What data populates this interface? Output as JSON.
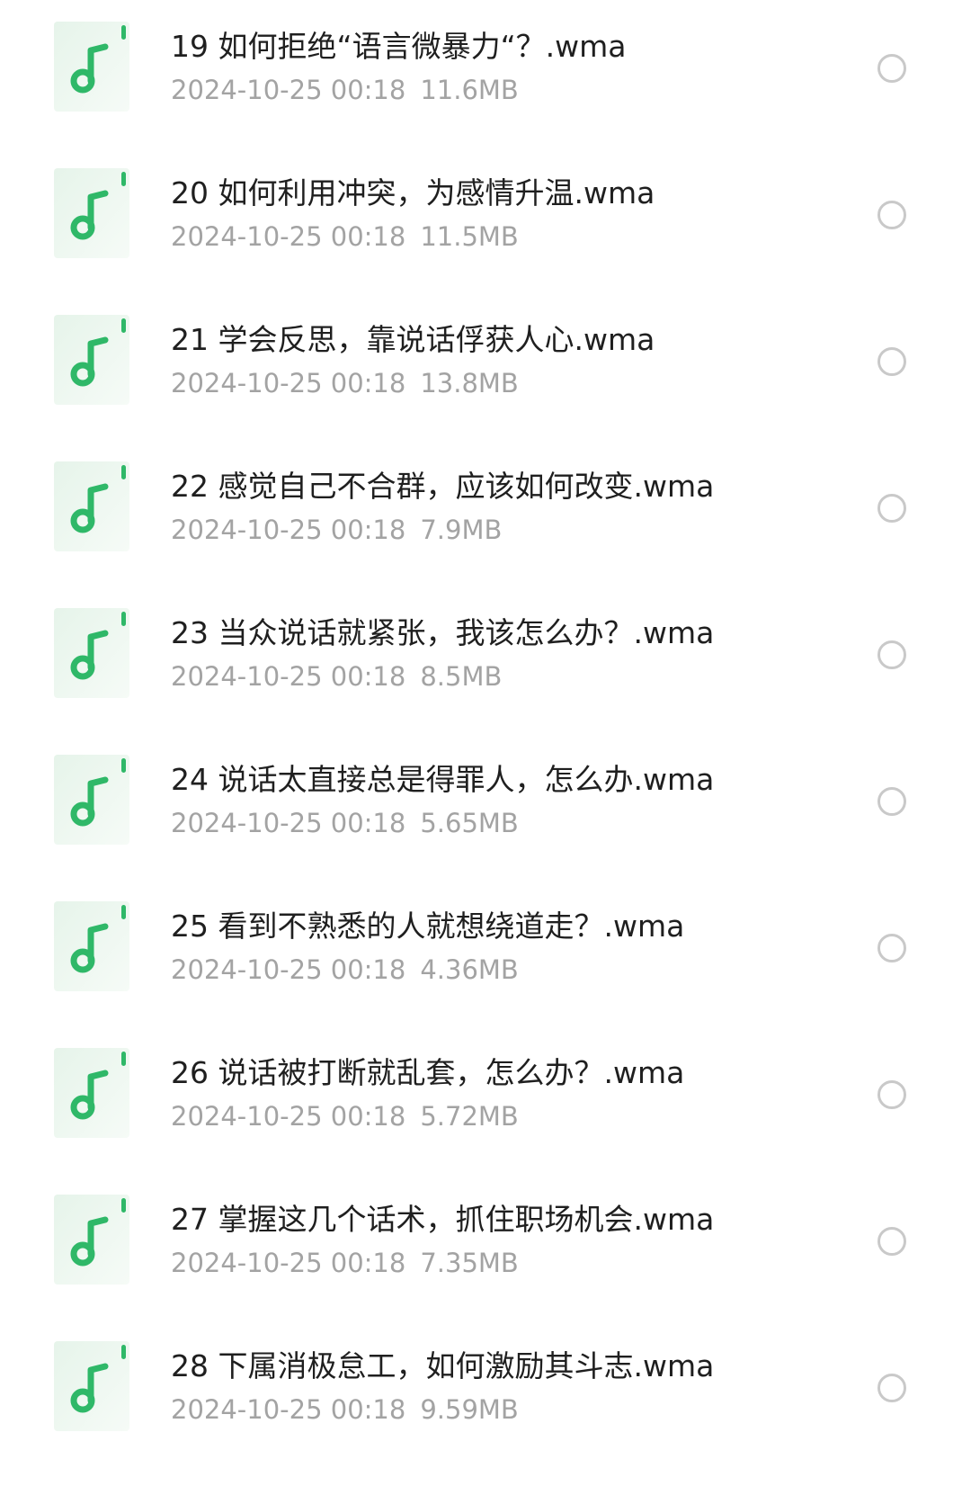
{
  "files": [
    {
      "name": "19 如何拒绝“语言微暴力“？.wma",
      "date": "2024-10-25 00:18",
      "size": "11.6MB",
      "icon": "music-file-icon"
    },
    {
      "name": "20 如何利用冲突，为感情升温.wma",
      "date": "2024-10-25 00:18",
      "size": "11.5MB",
      "icon": "music-file-icon"
    },
    {
      "name": "21 学会反思，靠说话俘获人心.wma",
      "date": "2024-10-25 00:18",
      "size": "13.8MB",
      "icon": "music-file-icon"
    },
    {
      "name": "22 感觉自己不合群，应该如何改变.wma",
      "date": "2024-10-25 00:18",
      "size": "7.9MB",
      "icon": "music-file-icon"
    },
    {
      "name": "23 当众说话就紧张，我该怎么办？.wma",
      "date": "2024-10-25 00:18",
      "size": "8.5MB",
      "icon": "music-file-icon"
    },
    {
      "name": "24 说话太直接总是得罪人，怎么办.wma",
      "date": "2024-10-25 00:18",
      "size": "5.65MB",
      "icon": "music-file-icon"
    },
    {
      "name": "25 看到不熟悉的人就想绕道走？.wma",
      "date": "2024-10-25 00:18",
      "size": "4.36MB",
      "icon": "music-file-icon"
    },
    {
      "name": "26 说话被打断就乱套，怎么办？.wma",
      "date": "2024-10-25 00:18",
      "size": "5.72MB",
      "icon": "music-file-icon"
    },
    {
      "name": "27 掌握这几个话术，抓住职场机会.wma",
      "date": "2024-10-25 00:18",
      "size": "7.35MB",
      "icon": "music-file-icon"
    },
    {
      "name": "28 下属消极怠工，如何激励其斗志.wma",
      "date": "2024-10-25 00:18",
      "size": "9.59MB",
      "icon": "music-file-icon"
    }
  ],
  "colors": {
    "icon_accent": "#2fb868",
    "icon_background": "#eef7f1",
    "title_text": "#1f1f1f",
    "meta_text": "#a3a3a3",
    "radio_border": "#c9c9c9"
  }
}
